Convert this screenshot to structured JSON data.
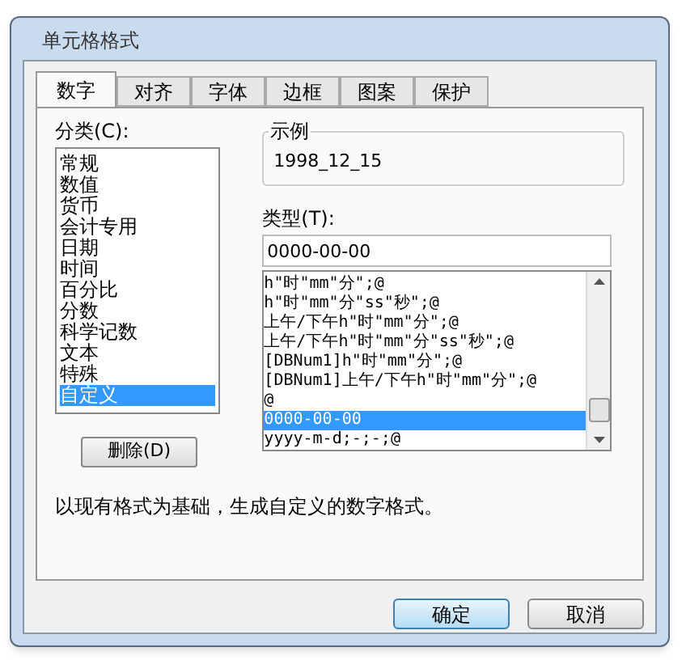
{
  "window": {
    "title": "单元格格式"
  },
  "tabs": [
    {
      "label": "数字",
      "selected": true
    },
    {
      "label": "对齐",
      "selected": false
    },
    {
      "label": "字体",
      "selected": false
    },
    {
      "label": "边框",
      "selected": false
    },
    {
      "label": "图案",
      "selected": false
    },
    {
      "label": "保护",
      "selected": false
    }
  ],
  "category": {
    "label": "分类(C):",
    "items": [
      {
        "label": "常规",
        "selected": false
      },
      {
        "label": "数值",
        "selected": false
      },
      {
        "label": "货币",
        "selected": false
      },
      {
        "label": "会计专用",
        "selected": false
      },
      {
        "label": "日期",
        "selected": false
      },
      {
        "label": "时间",
        "selected": false
      },
      {
        "label": "百分比",
        "selected": false
      },
      {
        "label": "分数",
        "selected": false
      },
      {
        "label": "科学记数",
        "selected": false
      },
      {
        "label": "文本",
        "selected": false
      },
      {
        "label": "特殊",
        "selected": false
      },
      {
        "label": "自定义",
        "selected": true
      }
    ],
    "delete_button": "删除(D)"
  },
  "sample": {
    "label": "示例",
    "value": "1998_12_15"
  },
  "type": {
    "label": "类型(T):",
    "value": "0000-00-00",
    "items": [
      {
        "label": "h\"时\"mm\"分\";@",
        "selected": false
      },
      {
        "label": "h\"时\"mm\"分\"ss\"秒\";@",
        "selected": false
      },
      {
        "label": "上午/下午h\"时\"mm\"分\";@",
        "selected": false
      },
      {
        "label": "上午/下午h\"时\"mm\"分\"ss\"秒\";@",
        "selected": false
      },
      {
        "label": "[DBNum1]h\"时\"mm\"分\";@",
        "selected": false
      },
      {
        "label": "[DBNum1]上午/下午h\"时\"mm\"分\";@",
        "selected": false
      },
      {
        "label": "@",
        "selected": false
      },
      {
        "label": "0000-00-00",
        "selected": true
      },
      {
        "label": "yyyy-m-d;-;-;@",
        "selected": false
      }
    ]
  },
  "description": "以现有格式为基础，生成自定义的数字格式。",
  "buttons": [
    {
      "label": "确定",
      "default": true
    },
    {
      "label": "取消",
      "default": false
    }
  ]
}
